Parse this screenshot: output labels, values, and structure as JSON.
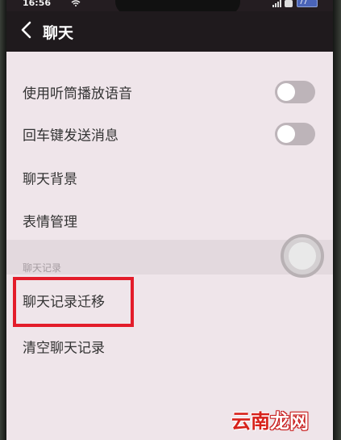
{
  "status_bar": {
    "time": "16:56",
    "battery": "77"
  },
  "header": {
    "title": "聊天"
  },
  "settings": {
    "rows": [
      {
        "label": "使用听筒播放语音",
        "toggle_on": false
      },
      {
        "label": "回车键发送消息",
        "toggle_on": false
      },
      {
        "label": "聊天背景"
      },
      {
        "label": "表情管理"
      }
    ],
    "section_title": "聊天记录",
    "section_rows": [
      {
        "label": "聊天记录迁移"
      },
      {
        "label": "清空聊天记录"
      }
    ]
  },
  "watermark": {
    "part1": "云南",
    "part2": "龙网"
  },
  "colors": {
    "highlight": "#e31c2a",
    "page_background": "#efe5ea",
    "header_background": "#1f1a1d"
  },
  "icons": {
    "back": "chevron-left-icon",
    "wifi": "wifi-icon",
    "battery": "battery-icon",
    "assistive": "assistive-touch-icon"
  }
}
